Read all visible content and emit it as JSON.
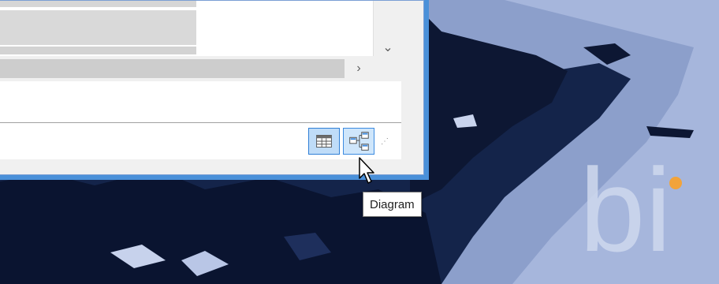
{
  "window": {
    "vscroll_down_glyph": "⌄",
    "hscroll_right_glyph": "›",
    "view_buttons": [
      {
        "name": "grid-view",
        "icon": "grid-icon"
      },
      {
        "name": "diagram-view",
        "icon": "diagram-icon"
      }
    ],
    "resize_grip_glyph": "⋰"
  },
  "tooltip": {
    "text": "Diagram"
  },
  "wallpaper": {
    "brand_fragment": "bi"
  },
  "colors": {
    "accent_border": "#4a90d9",
    "selected_button": "#cbe4fb",
    "wallpaper_sky": "#1b2c55",
    "wallpaper_snow": "#9fb0d6"
  }
}
